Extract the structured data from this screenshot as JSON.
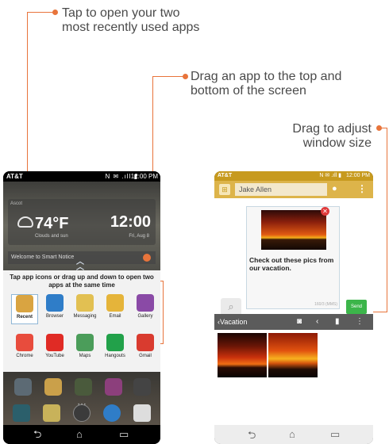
{
  "callouts": {
    "recent_apps": {
      "line1": "Tap to open your two",
      "line2": "most recently used apps"
    },
    "drag_app": {
      "line1": "Drag an app to the top and",
      "line2": "bottom of the screen"
    },
    "adjust": {
      "line1": "Drag to adjust",
      "line2": "window size"
    },
    "accent_color": "#e8743b"
  },
  "left_phone": {
    "status": {
      "carrier": "AT&T",
      "icons": "N ✉ .ıll ▮",
      "time": "12:00 PM"
    },
    "weather": {
      "location": "Ascot",
      "temp": "74°F",
      "condition": "Clouds and sun",
      "clock": "12:00",
      "date": "Fri, Aug 8"
    },
    "notice": "Welcome to Smart Notice",
    "popup": {
      "hint": "Tap app icons or drag up and down to open two apps at the same time",
      "row1": [
        {
          "label": "Recent",
          "icon": "recent-icon",
          "color": "#d9a441",
          "selected": true
        },
        {
          "label": "Browser",
          "icon": "browser-icon",
          "color": "#2f7dc8"
        },
        {
          "label": "Messaging",
          "icon": "messaging-icon",
          "color": "#e2c052"
        },
        {
          "label": "Email",
          "icon": "email-icon",
          "color": "#e5b43a"
        },
        {
          "label": "Gallery",
          "icon": "gallery-icon",
          "color": "#8a4aa6"
        }
      ],
      "row2": [
        {
          "label": "Chrome",
          "icon": "chrome-icon",
          "color": "#e84c3d"
        },
        {
          "label": "YouTube",
          "icon": "youtube-icon",
          "color": "#e02b25"
        },
        {
          "label": "Maps",
          "icon": "maps-icon",
          "color": "#4b9d5a"
        },
        {
          "label": "Hangouts",
          "icon": "hangouts-icon",
          "color": "#22a14a"
        },
        {
          "label": "Gmail",
          "icon": "gmail-icon",
          "color": "#d93b2f"
        }
      ]
    },
    "nav": {
      "back": "⮌",
      "home": "⌂",
      "recent": "▭"
    }
  },
  "right_phone": {
    "status": {
      "carrier": "AT&T",
      "icons": "N ✉ .ıll ▮",
      "time": "12:00 PM"
    },
    "message": {
      "recipient": "Jake Allen",
      "body": "Check out these pics from our vacation.",
      "counter": "160/3 (MMS)",
      "send_label": "Send"
    },
    "gallery": {
      "title": "‹Vacation"
    },
    "nav": {
      "back": "⮌",
      "home": "⌂",
      "recent": "▭"
    }
  }
}
